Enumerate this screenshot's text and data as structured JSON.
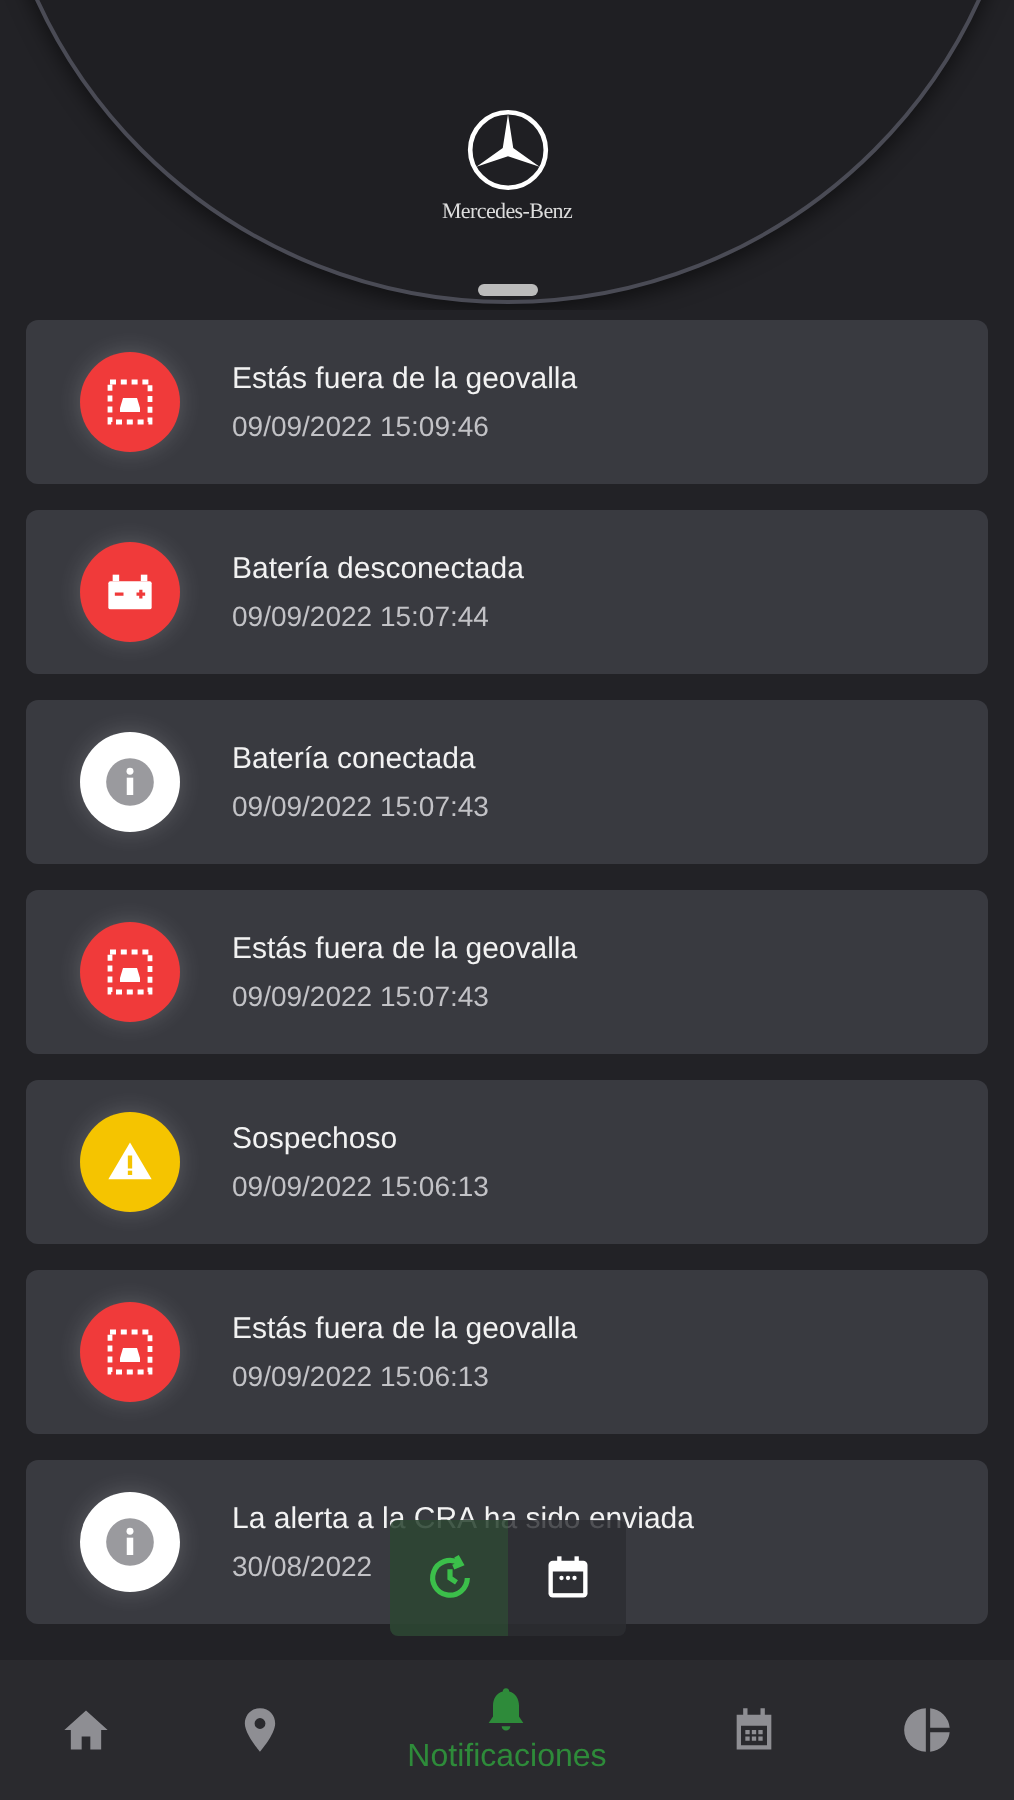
{
  "header": {
    "brand": "Mercedes-Benz"
  },
  "notifications": [
    {
      "kind": "geofence",
      "title": "Estás fuera de la geovalla",
      "time": "09/09/2022 15:09:46"
    },
    {
      "kind": "battery",
      "title": "Batería desconectada",
      "time": "09/09/2022 15:07:44"
    },
    {
      "kind": "info",
      "title": "Batería conectada",
      "time": "09/09/2022 15:07:43"
    },
    {
      "kind": "geofence",
      "title": "Estás fuera de la geovalla",
      "time": "09/09/2022 15:07:43"
    },
    {
      "kind": "warning",
      "title": "Sospechoso",
      "time": "09/09/2022 15:06:13"
    },
    {
      "kind": "geofence",
      "title": "Estás fuera de la geovalla",
      "time": "09/09/2022 15:06:13"
    },
    {
      "kind": "info",
      "title": "La alerta a la CRA ha sido enviada",
      "time": "30/08/2022"
    }
  ],
  "view_toggle": [
    {
      "kind": "history",
      "selected": true
    },
    {
      "kind": "calendar",
      "selected": false
    }
  ],
  "nav": [
    {
      "kind": "home",
      "selected": false
    },
    {
      "kind": "pin",
      "selected": false
    },
    {
      "kind": "bell",
      "label": "Notificaciones",
      "selected": true
    },
    {
      "kind": "calendar",
      "selected": false
    },
    {
      "kind": "pie",
      "selected": false
    }
  ]
}
